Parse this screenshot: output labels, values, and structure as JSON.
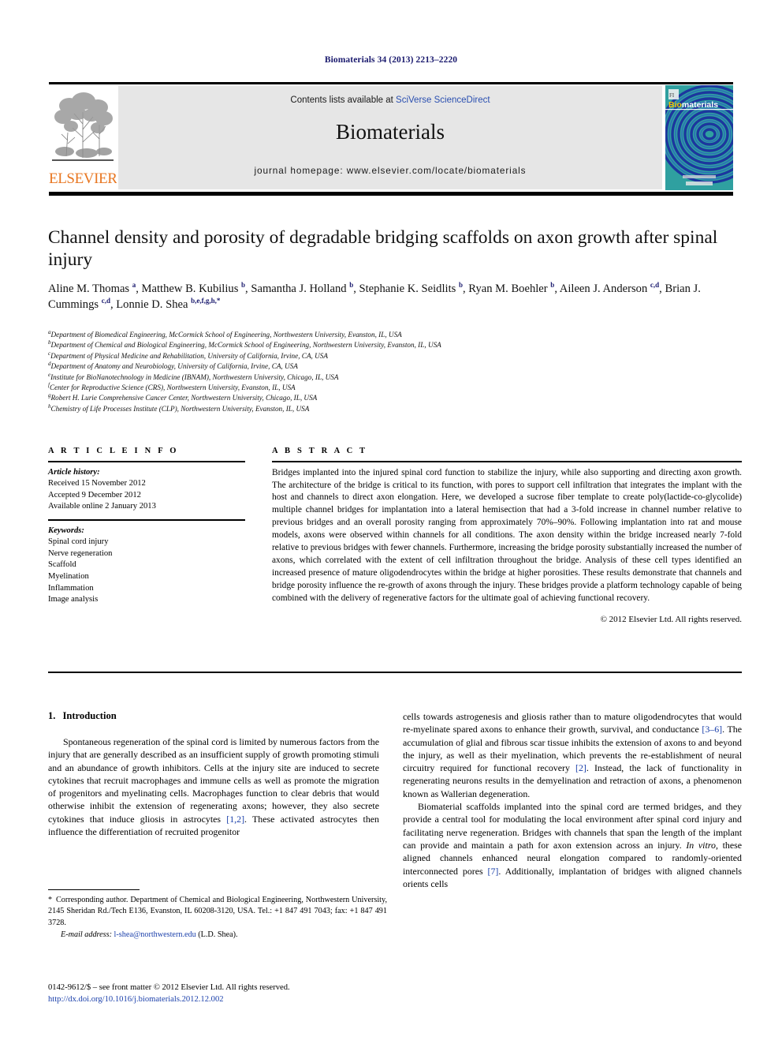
{
  "running_head": "Biomaterials 34 (2013) 2213–2220",
  "masthead": {
    "contents_prefix": "Contents lists available at ",
    "sciencedirect": "SciVerse ScienceDirect",
    "journal_name": "Biomaterials",
    "homepage": "journal homepage: www.elsevier.com/locate/biomaterials",
    "publisher_wordmark": "ELSEVIER",
    "cover_title_bio": "Bio",
    "cover_title_materials": "materials",
    "colors": {
      "elsevier_orange": "#E87722",
      "link_blue": "#2a4fb0",
      "banner_gray": "#e6e6e6",
      "cover_teal": "#2c9a9a",
      "cover_blue": "#1b2f9e"
    }
  },
  "article": {
    "title": "Channel density and porosity of degradable bridging scaffolds on axon growth after spinal injury",
    "authors_html": "Aline M. Thomas <sup>a</sup>, Matthew B. Kubilius <sup>b</sup>, Samantha J. Holland <sup>b</sup>, Stephanie K. Seidlits <sup>b</sup>, Ryan M. Boehler <sup>b</sup>, Aileen J. Anderson <sup>c,d</sup>, Brian J. Cummings <sup>c,d</sup>, Lonnie D. Shea <sup>b,e,f,g,h,</sup><sup>*</sup>",
    "affiliations": [
      {
        "mark": "a",
        "text": "Department of Biomedical Engineering, McCormick School of Engineering, Northwestern University, Evanston, IL, USA"
      },
      {
        "mark": "b",
        "text": "Department of Chemical and Biological Engineering, McCormick School of Engineering, Northwestern University, Evanston, IL, USA"
      },
      {
        "mark": "c",
        "text": "Department of Physical Medicine and Rehabilitation, University of California, Irvine, CA, USA"
      },
      {
        "mark": "d",
        "text": "Department of Anatomy and Neurobiology, University of California, Irvine, CA, USA"
      },
      {
        "mark": "e",
        "text": "Institute for BioNanotechnology in Medicine (IBNAM), Northwestern University, Chicago, IL, USA"
      },
      {
        "mark": "f",
        "text": "Center for Reproductive Science (CRS), Northwestern University, Evanston, IL, USA"
      },
      {
        "mark": "g",
        "text": "Robert H. Lurie Comprehensive Cancer Center, Northwestern University, Chicago, IL, USA"
      },
      {
        "mark": "h",
        "text": "Chemistry of Life Processes Institute (CLP), Northwestern University, Evanston, IL, USA"
      }
    ]
  },
  "article_info": {
    "heading": "A R T I C L E   I N F O",
    "history_label": "Article history:",
    "history": [
      "Received 15 November 2012",
      "Accepted 9 December 2012",
      "Available online 2 January 2013"
    ],
    "keywords_label": "Keywords:",
    "keywords": [
      "Spinal cord injury",
      "Nerve regeneration",
      "Scaffold",
      "Myelination",
      "Inflammation",
      "Image analysis"
    ]
  },
  "abstract": {
    "heading": "A B S T R A C T",
    "text": "Bridges implanted into the injured spinal cord function to stabilize the injury, while also supporting and directing axon growth. The architecture of the bridge is critical to its function, with pores to support cell infiltration that integrates the implant with the host and channels to direct axon elongation. Here, we developed a sucrose fiber template to create poly(lactide-co-glycolide) multiple channel bridges for implantation into a lateral hemisection that had a 3-fold increase in channel number relative to previous bridges and an overall porosity ranging from approximately 70%–90%. Following implantation into rat and mouse models, axons were observed within channels for all conditions. The axon density within the bridge increased nearly 7-fold relative to previous bridges with fewer channels. Furthermore, increasing the bridge porosity substantially increased the number of axons, which correlated with the extent of cell infiltration throughout the bridge. Analysis of these cell types identified an increased presence of mature oligodendrocytes within the bridge at higher porosities. These results demonstrate that channels and bridge porosity influence the re-growth of axons through the injury. These bridges provide a platform technology capable of being combined with the delivery of regenerative factors for the ultimate goal of achieving functional recovery.",
    "copyright": "© 2012 Elsevier Ltd. All rights reserved."
  },
  "body": {
    "section_number": "1.",
    "section_title": "Introduction",
    "left_paragraph_1_html": "Spontaneous regeneration of the spinal cord is limited by numerous factors from the injury that are generally described as an insufficient supply of growth promoting stimuli and an abundance of growth inhibitors. Cells at the injury site are induced to secrete cytokines that recruit macrophages and immune cells as well as promote the migration of progenitors and myelinating cells. Macrophages function to clear debris that would otherwise inhibit the extension of regenerating axons; however, they also secrete cytokines that induce gliosis in astrocytes <span class=\"ref\">[1,2]</span>. These activated astrocytes then influence the differentiation of recruited progenitor",
    "right_paragraph_1_html": "cells towards astrogenesis and gliosis rather than to mature oligodendrocytes that would re-myelinate spared axons to enhance their growth, survival, and conductance <span class=\"ref\">[3–6]</span>. The accumulation of glial and fibrous scar tissue inhibits the extension of axons to and beyond the injury, as well as their myelination, which prevents the re-establishment of neural circuitry required for functional recovery <span class=\"ref\">[2]</span>. Instead, the lack of functionality in regenerating neurons results in the demyelination and retraction of axons, a phenomenon known as Wallerian degeneration.",
    "right_paragraph_2_html": "Biomaterial scaffolds implanted into the spinal cord are termed bridges, and they provide a central tool for modulating the local environment after spinal cord injury and facilitating nerve regeneration. Bridges with channels that span the length of the implant can provide and maintain a path for axon extension across an injury. <span class=\"ital\">In vitro</span>, these aligned channels enhanced neural elongation compared to randomly-oriented interconnected pores <span class=\"ref\">[7]</span>. Additionally, implantation of bridges with aligned channels orients cells"
  },
  "footnote": {
    "star": "*",
    "corresponding_html": "Corresponding author. Department of Chemical and Biological Engineering, Northwestern University, 2145 Sheridan Rd./Tech E136, Evanston, IL 60208-3120, USA. Tel.: +1 847 491 7043; fax: +1 847 491 3728.",
    "email_label": "E-mail address:",
    "email": "l-shea@northwestern.edu",
    "email_suffix": "(L.D. Shea)."
  },
  "imprint": {
    "line1": "0142-9612/$ – see front matter © 2012 Elsevier Ltd. All rights reserved.",
    "doi": "http://dx.doi.org/10.1016/j.biomaterials.2012.12.002"
  }
}
